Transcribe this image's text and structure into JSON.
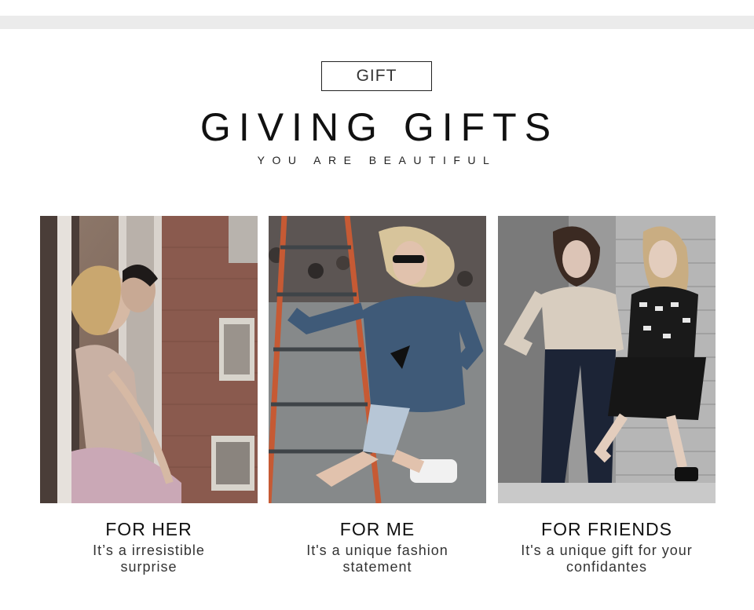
{
  "header": {
    "tag": "GIFT",
    "headline": "GIVING GIFTS",
    "tagline": "YOU ARE BEAUTIFUL"
  },
  "cards": [
    {
      "title": "FOR HER",
      "description": "It’s a irresistible surprise"
    },
    {
      "title": "FOR ME",
      "description": "It's a unique fashion statement"
    },
    {
      "title": "FOR FRIENDS",
      "description": "It's a unique gift for your confidantes"
    }
  ]
}
